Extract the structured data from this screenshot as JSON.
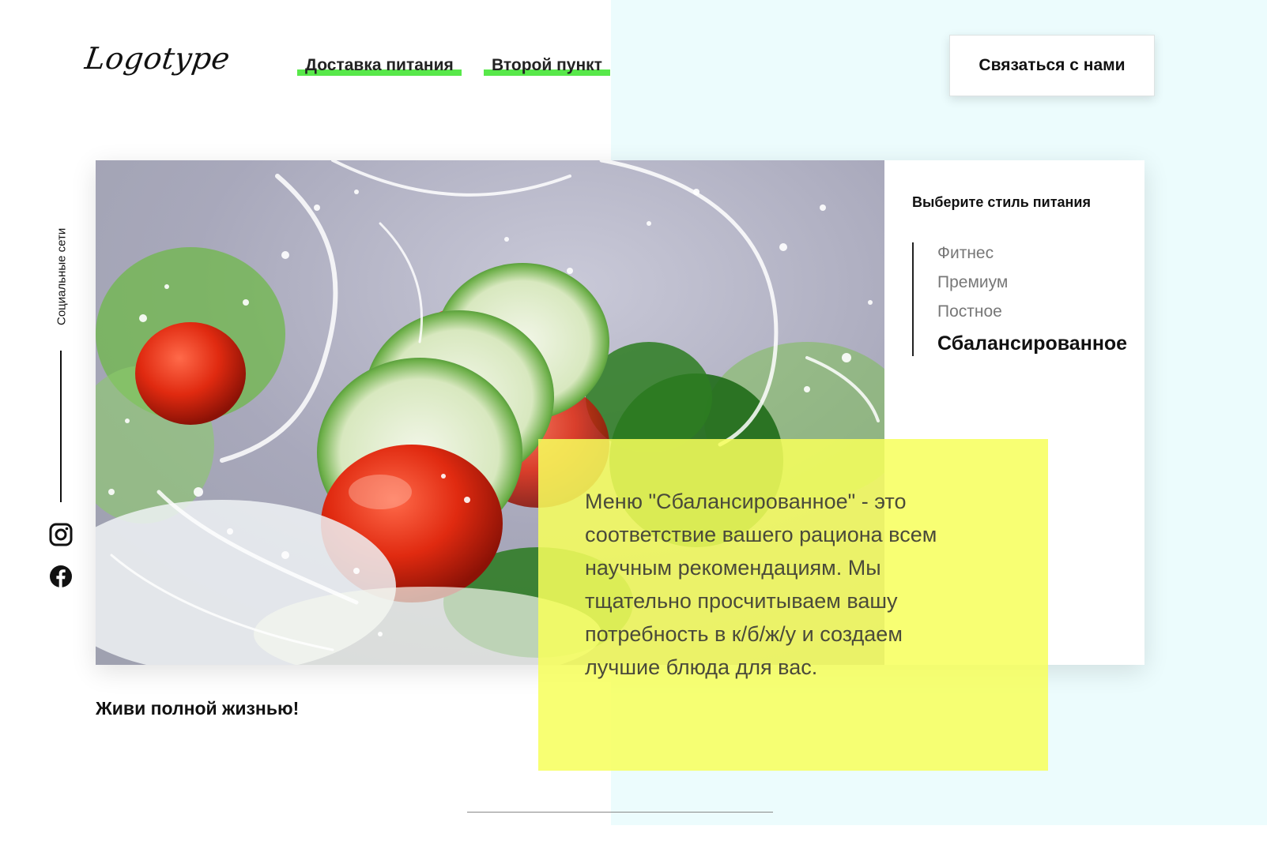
{
  "colors": {
    "accent_green": "#58e84a",
    "right_background": "#ecfcfd",
    "highlight_yellow": "#f7ff5c"
  },
  "header": {
    "logo": "Logotype",
    "nav": [
      {
        "label": "Доставка питания"
      },
      {
        "label": "Второй пункт"
      }
    ],
    "contact_button": "Связаться с нами"
  },
  "social": {
    "label": "Социальные сети",
    "icons": [
      "instagram-icon",
      "facebook-icon"
    ]
  },
  "hero": {
    "image": "salad-water-splash-photo",
    "style_panel": {
      "title": "Выберите стиль питания",
      "items": [
        {
          "label": "Фитнес",
          "active": false
        },
        {
          "label": "Премиум",
          "active": false
        },
        {
          "label": "Постное",
          "active": false
        },
        {
          "label": "Сбалансированное",
          "active": true
        }
      ]
    },
    "description": "Меню \"Сбалансированное\" - это соответствие вашего рациона всем научным рекомендациям. Мы тщательно просчитываем вашу потребность в к/б/ж/у и создаем лучшие блюда для вас.",
    "slogan": "Живи полной жизнью!"
  }
}
